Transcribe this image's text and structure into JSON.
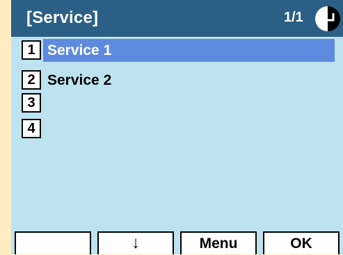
{
  "header": {
    "title": "[Service]",
    "page_indicator": "1/1",
    "nav_icon": "navigation-arrow-icon"
  },
  "list": {
    "items": [
      {
        "number": "1",
        "label": "Service 1",
        "selected": true
      },
      {
        "number": "2",
        "label": "Service 2",
        "selected": false
      },
      {
        "number": "3",
        "label": "",
        "selected": false
      },
      {
        "number": "4",
        "label": "",
        "selected": false
      }
    ]
  },
  "softkeys": [
    {
      "label": ""
    },
    {
      "label": "↓"
    },
    {
      "label": "Menu"
    },
    {
      "label": "OK"
    }
  ],
  "colors": {
    "header_bg": "#2b5f86",
    "screen_bg": "#bde3f0",
    "selection": "#5e8be0",
    "border": "#ffecc0"
  }
}
